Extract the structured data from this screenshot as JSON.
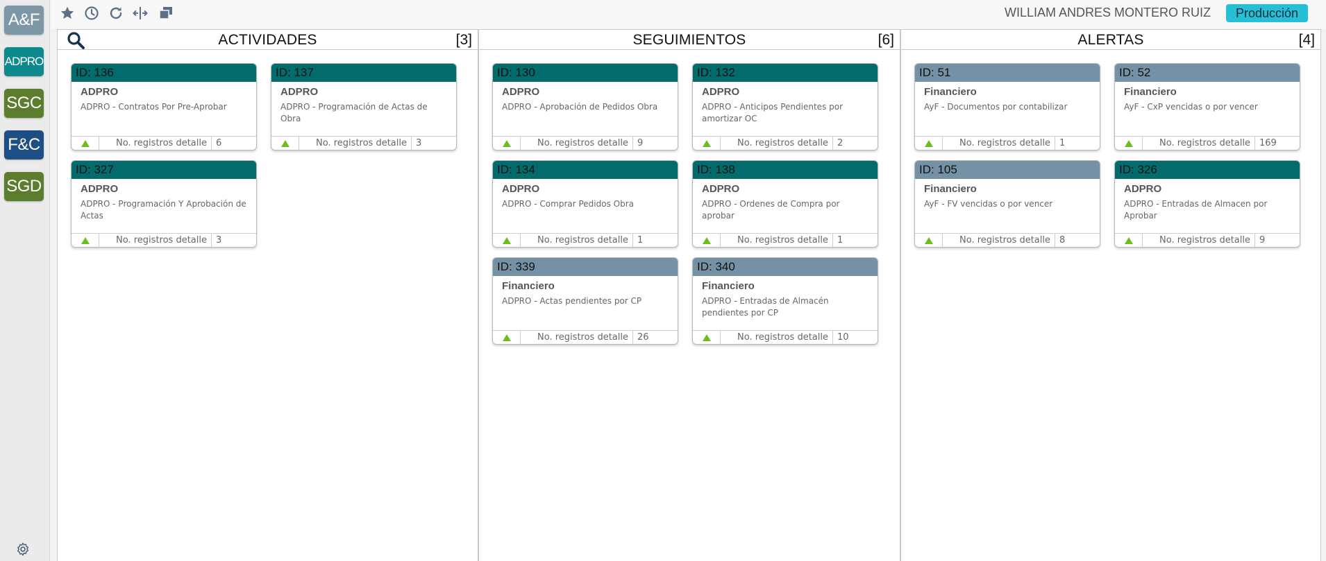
{
  "sidebar": {
    "modules": [
      {
        "label": "A&F",
        "color": "#7e97a6"
      },
      {
        "label": "ADPRO",
        "color": "#0f8a8c"
      },
      {
        "label": "SGC",
        "color": "#5c7d2d"
      },
      {
        "label": "F&C",
        "color": "#1d4f85"
      },
      {
        "label": "SGD",
        "color": "#5c7d2d"
      }
    ],
    "settings_icon": "gear-icon"
  },
  "topbar": {
    "icons": [
      "star-icon",
      "clock-icon",
      "refresh-icon",
      "split-columns-icon",
      "windows-icon"
    ],
    "user_name": "WILLIAM ANDRES MONTERO RUIZ",
    "environment": "Producción"
  },
  "colors": {
    "teal_header": "#036b6b",
    "gray_header": "#7491a6",
    "arrow_green": "#6abf1e",
    "badge": "#26bfd6"
  },
  "columns": [
    {
      "title": "ACTIVIDADES",
      "count": "[3]",
      "cards": [
        {
          "id": "ID: 136",
          "title": "ADPRO",
          "desc": "ADPRO - Contratos Por Pre-Aprobar",
          "foot_label": "No. registros detalle",
          "foot_value": "6",
          "header_color": "teal"
        },
        {
          "id": "ID: 137",
          "title": "ADPRO",
          "desc": "ADPRO - Programación de Actas de Obra",
          "foot_label": "No. registros detalle",
          "foot_value": "3",
          "header_color": "teal"
        },
        {
          "id": "ID: 327",
          "title": "ADPRO",
          "desc": "ADPRO - Programación Y Aprobación de Actas",
          "foot_label": "No. registros detalle",
          "foot_value": "3",
          "header_color": "teal"
        }
      ]
    },
    {
      "title": "SEGUIMIENTOS",
      "count": "[6]",
      "cards": [
        {
          "id": "ID: 130",
          "title": "ADPRO",
          "desc": "ADPRO - Aprobación de Pedidos Obra",
          "foot_label": "No. registros detalle",
          "foot_value": "9",
          "header_color": "teal"
        },
        {
          "id": "ID: 132",
          "title": "ADPRO",
          "desc": "ADPRO - Anticipos Pendientes por amortizar OC",
          "foot_label": "No. registros detalle",
          "foot_value": "2",
          "header_color": "teal"
        },
        {
          "id": "ID: 134",
          "title": "ADPRO",
          "desc": "ADPRO - Comprar Pedidos Obra",
          "foot_label": "No. registros detalle",
          "foot_value": "1",
          "header_color": "teal"
        },
        {
          "id": "ID: 138",
          "title": "ADPRO",
          "desc": "ADPRO - Ordenes de Compra por aprobar",
          "foot_label": "No. registros detalle",
          "foot_value": "1",
          "header_color": "teal"
        },
        {
          "id": "ID: 339",
          "title": "Financiero",
          "desc": "ADPRO - Actas pendientes por CP",
          "foot_label": "No. registros detalle",
          "foot_value": "26",
          "header_color": "gray"
        },
        {
          "id": "ID: 340",
          "title": "Financiero",
          "desc": "ADPRO - Entradas de Almacén pendientes por CP",
          "foot_label": "No. registros detalle",
          "foot_value": "10",
          "header_color": "gray"
        }
      ]
    },
    {
      "title": "ALERTAS",
      "count": "[4]",
      "cards": [
        {
          "id": "ID: 51",
          "title": "Financiero",
          "desc": "AyF - Documentos por contabilizar",
          "foot_label": "No. registros detalle",
          "foot_value": "1",
          "header_color": "gray"
        },
        {
          "id": "ID: 52",
          "title": "Financiero",
          "desc": "AyF - CxP vencidas o por vencer",
          "foot_label": "No. registros detalle",
          "foot_value": "169",
          "header_color": "gray"
        },
        {
          "id": "ID: 105",
          "title": "Financiero",
          "desc": "AyF - FV vencidas o por vencer",
          "foot_label": "No. registros detalle",
          "foot_value": "8",
          "header_color": "gray"
        },
        {
          "id": "ID: 326",
          "title": "ADPRO",
          "desc": "ADPRO - Entradas de Almacen por Aprobar",
          "foot_label": "No. registros detalle",
          "foot_value": "9",
          "header_color": "teal"
        }
      ]
    }
  ]
}
